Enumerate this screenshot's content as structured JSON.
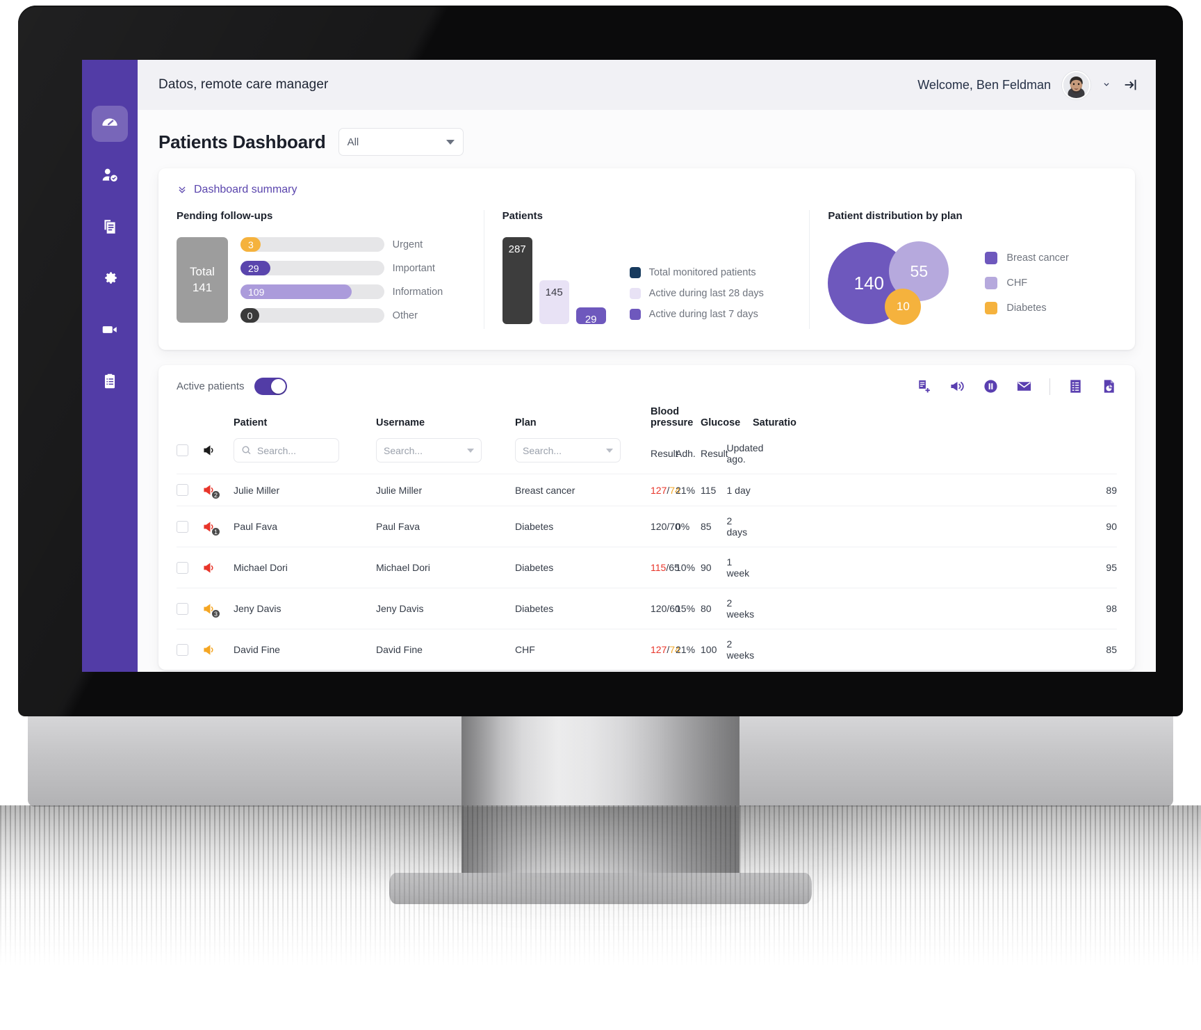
{
  "brand": {
    "sidebar_color": "#523ca6",
    "accent": "#5a45ad",
    "orange": "#f5b23d",
    "red": "#e8352a"
  },
  "topbar": {
    "app_title": "Datos, remote care manager",
    "welcome": "Welcome, Ben Feldman",
    "avatar_name": "avatar",
    "chevron": "chevron-down-icon",
    "logout": "logout-icon"
  },
  "sidebar": {
    "items": [
      {
        "name": "dashboard",
        "icon": "gauge-icon",
        "active": true
      },
      {
        "name": "patients",
        "icon": "user-check-icon",
        "active": false
      },
      {
        "name": "documents",
        "icon": "copy-documents-icon",
        "active": false
      },
      {
        "name": "settings",
        "icon": "gear-icon",
        "active": false
      },
      {
        "name": "video-visits",
        "icon": "video-camera-icon",
        "active": false
      },
      {
        "name": "reports",
        "icon": "clipboard-list-icon",
        "active": false
      }
    ]
  },
  "page": {
    "title": "Patients Dashboard",
    "filter_value": "All",
    "summary_label": "Dashboard summary"
  },
  "chart_data": [
    {
      "type": "bar",
      "title": "Pending follow-ups",
      "orientation": "horizontal",
      "total_label": "Total",
      "total_value": "141",
      "categories": [
        "Urgent",
        "Important",
        "Information",
        "Other"
      ],
      "values": [
        3,
        29,
        109,
        0
      ],
      "value_labels": [
        "3",
        "29",
        "109",
        "0"
      ],
      "colors": [
        "#f5b23d",
        "#5a45ad",
        "#ab9bdb",
        "#3a3a3a"
      ],
      "max": 141,
      "grid": false,
      "xlabel": "",
      "ylabel": ""
    },
    {
      "type": "bar",
      "title": "Patients",
      "orientation": "vertical",
      "categories": [
        "Total monitored patients",
        "Active during last 28 days",
        "Active during last 7 days"
      ],
      "values": [
        287,
        145,
        29
      ],
      "value_labels": [
        "287",
        "145",
        "29"
      ],
      "bar_colors": [
        "#3d3d3d",
        "#e8e2f5",
        "#6e58bd"
      ],
      "legend_colors": [
        "#173a5e",
        "#e8e2f5",
        "#6e58bd"
      ],
      "legend": [
        "Total monitored patients",
        "Active during last 28 days",
        "Active during last 7 days"
      ],
      "legend_position": "right",
      "ylim": [
        0,
        287
      ],
      "grid": false
    },
    {
      "type": "pie",
      "subtype": "bubble",
      "title": "Patient distribution by plan",
      "categories": [
        "Breast cancer",
        "CHF",
        "Diabetes"
      ],
      "values": [
        140,
        55,
        10
      ],
      "value_labels": [
        "140",
        "55",
        "10"
      ],
      "colors": [
        "#6e58bd",
        "#b6a9dd",
        "#f5b23d"
      ],
      "legend": [
        "Breast cancer",
        "CHF",
        "Diabetes"
      ],
      "legend_position": "right"
    }
  ],
  "table": {
    "active_patients_label": "Active patients",
    "toggle_on": true,
    "tools": [
      {
        "name": "add-to-list-icon"
      },
      {
        "name": "megaphone-icon"
      },
      {
        "name": "pause-icon"
      },
      {
        "name": "envelope-icon"
      },
      {
        "name": "divider"
      },
      {
        "name": "document-list-icon"
      },
      {
        "name": "file-report-icon"
      }
    ],
    "headers": {
      "patient": "Patient",
      "username": "Username",
      "plan": "Plan",
      "blood_pressure": "Blood pressure",
      "glucose": "Glucose",
      "saturation": "Saturatio",
      "bp_result": "Result",
      "bp_adh": "Adh.",
      "glu_result": "Result",
      "glu_updated": "Updated ago."
    },
    "filters": {
      "patient_placeholder": "Search...",
      "username_placeholder": "Search...",
      "plan_placeholder": "Search..."
    },
    "rows": [
      {
        "flag_color": "#e8352a",
        "badge": "2",
        "patient": "Julie Miller",
        "username": "Julie Miller",
        "plan": "Breast cancer",
        "bp_sys": "127",
        "bp_sep": "/",
        "bp_dia": "74",
        "bp_sys_alert": true,
        "bp_dia_alert": "orange",
        "adh": "21%",
        "adh_alert": true,
        "glucose": "115",
        "updated": "1 day",
        "saturation": "89"
      },
      {
        "flag_color": "#e8352a",
        "badge": "1",
        "patient": "Paul Fava",
        "username": "Paul Fava",
        "plan": "Diabetes",
        "bp_sys": "120",
        "bp_sep": "/",
        "bp_dia": "70",
        "bp_sys_alert": false,
        "bp_dia_alert": "none",
        "adh": "0%",
        "adh_alert": false,
        "glucose": "85",
        "updated": "2 days",
        "saturation": "90"
      },
      {
        "flag_color": "#e8352a",
        "badge": "",
        "patient": "Michael Dori",
        "username": "Michael Dori",
        "plan": "Diabetes",
        "bp_sys": "115",
        "bp_sep": "/",
        "bp_dia": "65",
        "bp_sys_alert": true,
        "bp_dia_alert": "none",
        "adh": "10%",
        "adh_alert": true,
        "glucose": "90",
        "updated": "1 week",
        "saturation": "95"
      },
      {
        "flag_color": "#f5a623",
        "badge": "3",
        "patient": "Jeny Davis",
        "username": "Jeny Davis",
        "plan": "Diabetes",
        "bp_sys": "120",
        "bp_sep": "/",
        "bp_dia": "60",
        "bp_sys_alert": false,
        "bp_dia_alert": "none",
        "adh": "15%",
        "adh_alert": false,
        "glucose": "80",
        "updated": "2 weeks",
        "saturation": "98"
      },
      {
        "flag_color": "#f5a623",
        "badge": "",
        "patient": "David Fine",
        "username": "David Fine",
        "plan": "CHF",
        "bp_sys": "127",
        "bp_sep": "/",
        "bp_dia": "74",
        "bp_sys_alert": true,
        "bp_dia_alert": "orange",
        "adh": "21%",
        "adh_alert": true,
        "glucose": "100",
        "updated": "2 weeks",
        "saturation": "85"
      }
    ]
  }
}
